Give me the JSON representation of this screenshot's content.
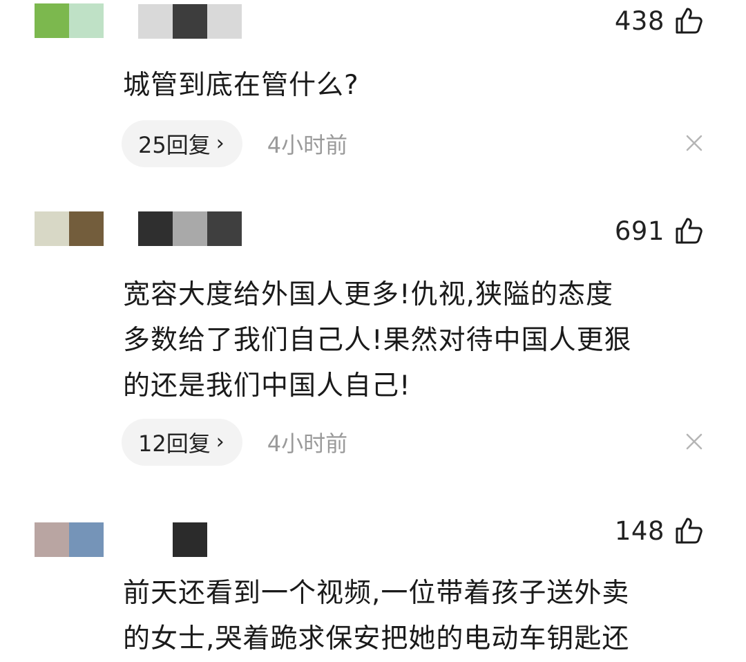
{
  "comments": [
    {
      "likes": "438",
      "text_lines": [
        "城管到底在管什么?"
      ],
      "replies": "25回复",
      "time": "4小时前"
    },
    {
      "likes": "691",
      "text_lines": [
        "宽容大度给外国人更多!仇视,狭隘的态度",
        "多数给了我们自己人!果然对待中国人更狠",
        "的还是我们中国人自己!"
      ],
      "replies": "12回复",
      "time": "4小时前"
    },
    {
      "likes": "148",
      "text_lines": [
        "前天还看到一个视频,一位带着孩子送外卖",
        "的女士,哭着跪求保安把她的电动车钥匙还"
      ]
    }
  ],
  "icons": {
    "like": "thumbs-up-icon",
    "reply_chevron": "chevron-right-icon",
    "dismiss": "close-icon"
  },
  "colors": {
    "text": "#1a1a1a",
    "meta": "#9a9a9a",
    "pill": "#f3f3f3",
    "background": "#ffffff"
  }
}
